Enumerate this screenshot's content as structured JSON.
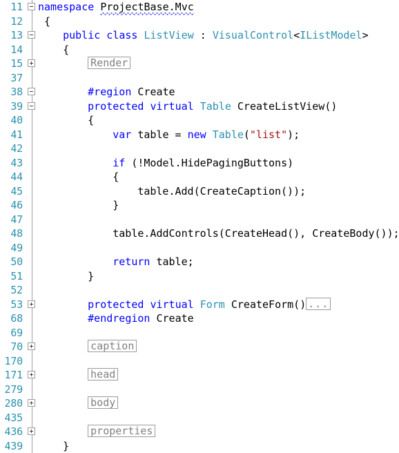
{
  "editor": {
    "language": "csharp",
    "colors": {
      "background": "#ffffff",
      "foreground": "#000000",
      "line_number": "#2b91af",
      "keyword": "#0000ff",
      "type": "#2b91af",
      "string": "#a31515",
      "preprocessor": "#0000ff",
      "collapsed_text": "#808080",
      "outline_border": "#9a9a9a",
      "squiggle": "#6a6af0"
    },
    "lines": [
      {
        "number": "11",
        "marker": "minus",
        "guide": "none",
        "indent": 0,
        "tokens": [
          {
            "t": "namespace",
            "c": "kw"
          },
          {
            "t": " ",
            "c": "plain"
          },
          {
            "t": "ProjectBase.Mvc",
            "c": "plain",
            "squiggle": true
          }
        ]
      },
      {
        "number": "12",
        "marker": "none",
        "guide": "full",
        "indent": 1,
        "tokens": [
          {
            "t": "{",
            "c": "plain"
          }
        ]
      },
      {
        "number": "13",
        "marker": "minus",
        "guide": "none",
        "indent": 4,
        "tokens": [
          {
            "t": "public",
            "c": "kw"
          },
          {
            "t": " ",
            "c": "plain"
          },
          {
            "t": "class",
            "c": "kw"
          },
          {
            "t": " ",
            "c": "plain"
          },
          {
            "t": "ListView",
            "c": "type"
          },
          {
            "t": " : ",
            "c": "plain"
          },
          {
            "t": "VisualControl",
            "c": "type"
          },
          {
            "t": "<",
            "c": "plain"
          },
          {
            "t": "IListModel",
            "c": "type"
          },
          {
            "t": ">",
            "c": "plain"
          }
        ]
      },
      {
        "number": "14",
        "marker": "none",
        "guide": "full",
        "indent": 4,
        "tokens": [
          {
            "t": "{",
            "c": "plain"
          }
        ]
      },
      {
        "number": "15",
        "marker": "plus",
        "guide": "none",
        "indent": 8,
        "tokens": [
          {
            "t": "Render",
            "c": "collapsed"
          }
        ]
      },
      {
        "number": "37",
        "marker": "none",
        "guide": "full",
        "indent": 0,
        "tokens": []
      },
      {
        "number": "38",
        "marker": "minus",
        "guide": "none",
        "indent": 8,
        "tokens": [
          {
            "t": "#region",
            "c": "pp"
          },
          {
            "t": " Create",
            "c": "plain"
          }
        ]
      },
      {
        "number": "39",
        "marker": "minus",
        "guide": "none",
        "indent": 8,
        "tokens": [
          {
            "t": "protected",
            "c": "kw"
          },
          {
            "t": " ",
            "c": "plain"
          },
          {
            "t": "virtual",
            "c": "kw"
          },
          {
            "t": " ",
            "c": "plain"
          },
          {
            "t": "Table",
            "c": "type"
          },
          {
            "t": " CreateListView()",
            "c": "plain"
          }
        ]
      },
      {
        "number": "40",
        "marker": "none",
        "guide": "full",
        "indent": 8,
        "tokens": [
          {
            "t": "{",
            "c": "plain"
          }
        ]
      },
      {
        "number": "41",
        "marker": "none",
        "guide": "full",
        "indent": 12,
        "tokens": [
          {
            "t": "var",
            "c": "kw"
          },
          {
            "t": " table = ",
            "c": "plain"
          },
          {
            "t": "new",
            "c": "kw"
          },
          {
            "t": " ",
            "c": "plain"
          },
          {
            "t": "Table",
            "c": "type"
          },
          {
            "t": "(",
            "c": "plain"
          },
          {
            "t": "\"list\"",
            "c": "str"
          },
          {
            "t": ");",
            "c": "plain"
          }
        ]
      },
      {
        "number": "42",
        "marker": "none",
        "guide": "full",
        "indent": 0,
        "tokens": []
      },
      {
        "number": "43",
        "marker": "none",
        "guide": "full",
        "indent": 12,
        "tokens": [
          {
            "t": "if",
            "c": "kw"
          },
          {
            "t": " (!Model.HidePagingButtons)",
            "c": "plain"
          }
        ]
      },
      {
        "number": "44",
        "marker": "none",
        "guide": "full",
        "indent": 12,
        "tokens": [
          {
            "t": "{",
            "c": "plain"
          }
        ]
      },
      {
        "number": "45",
        "marker": "none",
        "guide": "full",
        "indent": 16,
        "tokens": [
          {
            "t": "table.Add(CreateCaption());",
            "c": "plain"
          }
        ]
      },
      {
        "number": "46",
        "marker": "none",
        "guide": "full",
        "indent": 12,
        "tokens": [
          {
            "t": "}",
            "c": "plain"
          }
        ]
      },
      {
        "number": "47",
        "marker": "none",
        "guide": "full",
        "indent": 0,
        "tokens": []
      },
      {
        "number": "48",
        "marker": "none",
        "guide": "full",
        "indent": 12,
        "tokens": [
          {
            "t": "table.AddControls(CreateHead(), CreateBody());",
            "c": "plain"
          }
        ]
      },
      {
        "number": "49",
        "marker": "none",
        "guide": "full",
        "indent": 0,
        "tokens": []
      },
      {
        "number": "50",
        "marker": "none",
        "guide": "full",
        "indent": 12,
        "tokens": [
          {
            "t": "return",
            "c": "kw"
          },
          {
            "t": " table;",
            "c": "plain"
          }
        ]
      },
      {
        "number": "51",
        "marker": "none",
        "guide": "full",
        "indent": 8,
        "tokens": [
          {
            "t": "}",
            "c": "plain"
          }
        ]
      },
      {
        "number": "52",
        "marker": "none",
        "guide": "full",
        "indent": 0,
        "tokens": []
      },
      {
        "number": "53",
        "marker": "plus",
        "guide": "none",
        "indent": 8,
        "tokens": [
          {
            "t": "protected",
            "c": "kw"
          },
          {
            "t": " ",
            "c": "plain"
          },
          {
            "t": "virtual",
            "c": "kw"
          },
          {
            "t": " ",
            "c": "plain"
          },
          {
            "t": "Form",
            "c": "type"
          },
          {
            "t": " CreateForm()",
            "c": "plain"
          },
          {
            "t": "...",
            "c": "ellipsis"
          }
        ]
      },
      {
        "number": "68",
        "marker": "none",
        "guide": "full",
        "indent": 8,
        "tokens": [
          {
            "t": "#endregion",
            "c": "pp"
          },
          {
            "t": " Create",
            "c": "plain"
          }
        ]
      },
      {
        "number": "69",
        "marker": "none",
        "guide": "full",
        "indent": 0,
        "tokens": []
      },
      {
        "number": "70",
        "marker": "plus",
        "guide": "none",
        "indent": 8,
        "tokens": [
          {
            "t": "caption",
            "c": "collapsed"
          }
        ]
      },
      {
        "number": "170",
        "marker": "none",
        "guide": "full",
        "indent": 0,
        "tokens": []
      },
      {
        "number": "171",
        "marker": "plus",
        "guide": "none",
        "indent": 8,
        "tokens": [
          {
            "t": "head",
            "c": "collapsed"
          }
        ]
      },
      {
        "number": "279",
        "marker": "none",
        "guide": "full",
        "indent": 0,
        "tokens": []
      },
      {
        "number": "280",
        "marker": "plus",
        "guide": "none",
        "indent": 8,
        "tokens": [
          {
            "t": "body",
            "c": "collapsed"
          }
        ]
      },
      {
        "number": "435",
        "marker": "none",
        "guide": "full",
        "indent": 0,
        "tokens": []
      },
      {
        "number": "436",
        "marker": "plus",
        "guide": "none",
        "indent": 8,
        "tokens": [
          {
            "t": "properties",
            "c": "collapsed"
          }
        ]
      },
      {
        "number": "439",
        "marker": "none",
        "guide": "full",
        "indent": 4,
        "tokens": [
          {
            "t": "}",
            "c": "plain"
          }
        ]
      }
    ]
  }
}
